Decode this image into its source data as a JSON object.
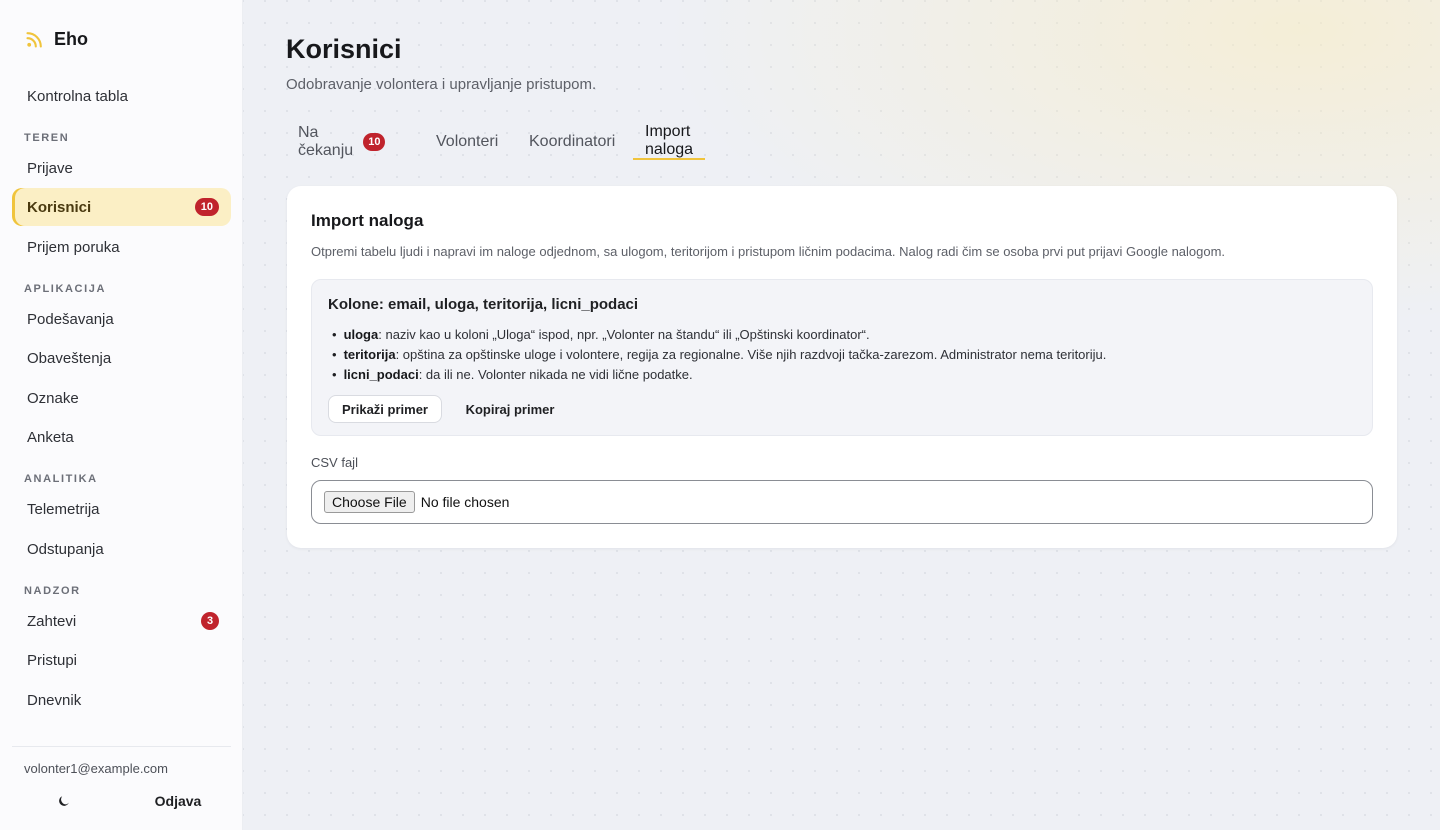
{
  "app": {
    "name": "Eho",
    "logo_icon": "rss-icon",
    "accent_color": "#f0c43c",
    "badge_color": "#c0232c"
  },
  "sidebar": {
    "items": [
      {
        "label": "Kontrolna tabla"
      },
      {
        "section": "TEREN"
      },
      {
        "label": "Prijave"
      },
      {
        "label": "Korisnici",
        "badge": "10",
        "active": true
      },
      {
        "label": "Prijem poruka"
      },
      {
        "section": "APLIKACIJA"
      },
      {
        "label": "Podešavanja"
      },
      {
        "label": "Obaveštenja"
      },
      {
        "label": "Oznake"
      },
      {
        "label": "Anketa"
      },
      {
        "section": "ANALITIKA"
      },
      {
        "label": "Telemetrija"
      },
      {
        "label": "Odstupanja"
      },
      {
        "section": "NADZOR"
      },
      {
        "label": "Zahtevi",
        "badge": "3"
      },
      {
        "label": "Pristupi"
      },
      {
        "label": "Dnevnik"
      }
    ],
    "user_email": "volonter1@example.com",
    "theme_icon": "moon-icon",
    "logout_label": "Odjava"
  },
  "page": {
    "title": "Korisnici",
    "subtitle": "Odobravanje volontera i upravljanje pristupom."
  },
  "tabs": [
    {
      "label": "Na čekanju",
      "badge": "10"
    },
    {
      "label": "Volonteri"
    },
    {
      "label": "Koordinatori"
    },
    {
      "label": "Import naloga",
      "active": true
    }
  ],
  "card": {
    "title": "Import naloga",
    "description": "Otpremi tabelu ljudi i napravi im naloge odjednom, sa ulogom, teritorijom i pristupom ličnim podacima. Nalog radi čim se osoba prvi put prijavi Google nalogom.",
    "info": {
      "title": "Kolone: email, uloga, teritorija, licni_podaci",
      "items": [
        {
          "term": "uloga",
          "text": ": naziv kao u koloni „Uloga“ ispod, npr. „Volonter na štandu“ ili „Opštinski koordinator“."
        },
        {
          "term": "teritorija",
          "text": ": opština za opštinske uloge i volontere, regija za regionalne. Više njih razdvoji tačka-zarezom. Administrator nema teritoriju."
        },
        {
          "term": "licni_podaci",
          "text": ": da ili ne. Volonter nikada ne vidi lične podatke."
        }
      ],
      "show_example_label": "Prikaži primer",
      "copy_example_label": "Kopiraj primer"
    },
    "csv_label": "CSV fajl",
    "choose_file_label": "Choose File",
    "file_status": "No file chosen"
  }
}
